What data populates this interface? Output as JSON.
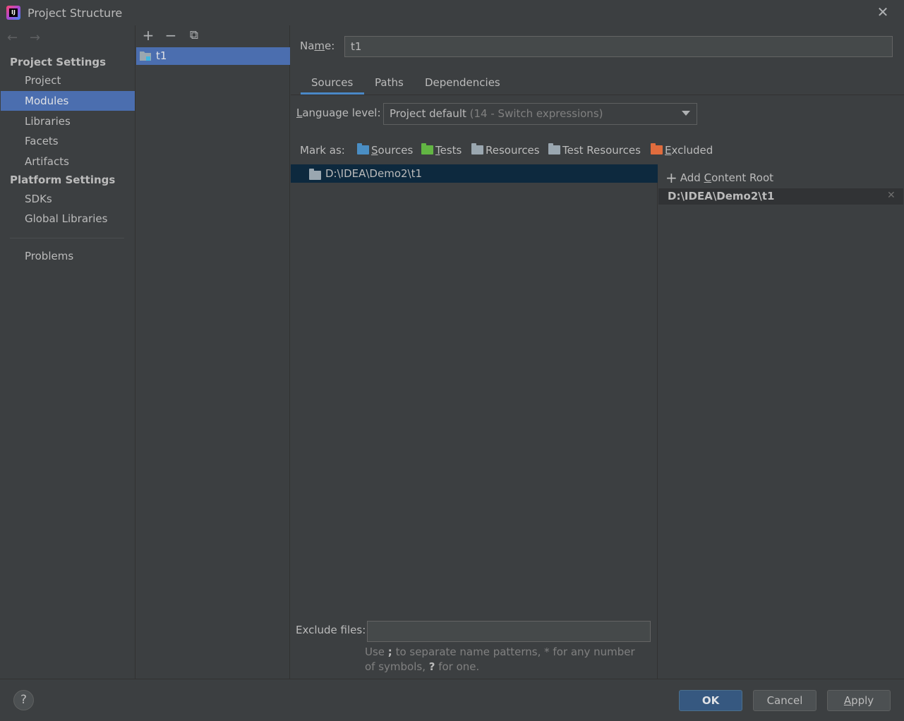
{
  "window": {
    "title": "Project Structure",
    "logo_text": "IJ"
  },
  "nav": {
    "project_settings_header": "Project Settings",
    "project_items": [
      {
        "label": "Project"
      },
      {
        "label": "Modules",
        "selected": true
      },
      {
        "label": "Libraries"
      },
      {
        "label": "Facets"
      },
      {
        "label": "Artifacts"
      }
    ],
    "platform_settings_header": "Platform Settings",
    "platform_items": [
      {
        "label": "SDKs"
      },
      {
        "label": "Global Libraries"
      }
    ],
    "problems_label": "Problems"
  },
  "modules": {
    "toolbar": {
      "add": "+",
      "remove": "−",
      "copy": "⧉"
    },
    "items": [
      {
        "label": "t1",
        "selected": true
      }
    ]
  },
  "module_settings": {
    "name_label_pre": "Na",
    "name_label_mnemonic": "m",
    "name_label_post": "e:",
    "name_value": "t1",
    "tabs": [
      {
        "label": "Sources",
        "active": true
      },
      {
        "label": "Paths"
      },
      {
        "label": "Dependencies"
      }
    ],
    "language_level_label_mnemonic": "L",
    "language_level_label_rest": "anguage level:",
    "language_level_value": "Project default",
    "language_level_hint": "(14 - Switch expressions)",
    "mark_as_label": "Mark as:",
    "mark_as": [
      {
        "mnemonic": "S",
        "rest": "ources",
        "color": "#4a8ec4"
      },
      {
        "mnemonic": "T",
        "rest": "ests",
        "color": "#62b543"
      },
      {
        "mnemonic": "",
        "rest": "Resources",
        "color": "#9aa7b0"
      },
      {
        "mnemonic": "",
        "rest": "Test Resources",
        "color": "#9aa7b0"
      },
      {
        "mnemonic": "E",
        "rest": "xcluded",
        "color": "#e06c3d"
      }
    ],
    "tree_root": "D:\\IDEA\\Demo2\\t1",
    "add_content_root_pre": "Add ",
    "add_content_root_mnemonic": "C",
    "add_content_root_post": "ontent Root",
    "content_root": "D:\\IDEA\\Demo2\\t1",
    "exclude_files_label": "Exclude files:",
    "exclude_files_value": "",
    "exclude_hint_1": "Use ",
    "exclude_hint_bold_1": ";",
    "exclude_hint_2": " to separate name patterns, * for any number of symbols, ",
    "exclude_hint_bold_2": "?",
    "exclude_hint_3": " for one."
  },
  "buttons": {
    "help": "?",
    "ok": "OK",
    "cancel": "Cancel",
    "apply_mnemonic": "A",
    "apply_rest": "pply"
  },
  "colors": {
    "selection": "#4b6eaf",
    "tree_selection": "#0d293e",
    "accent_tab": "#4a88c7",
    "ok_button": "#365880"
  }
}
